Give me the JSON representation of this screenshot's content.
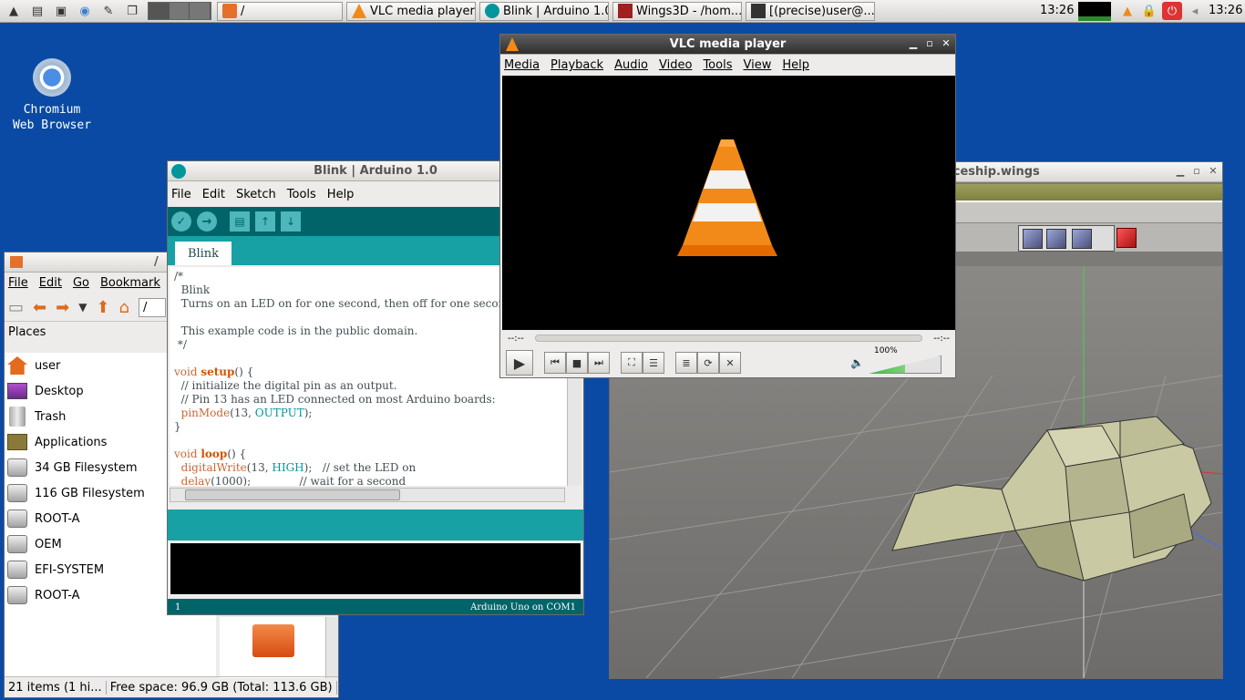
{
  "taskbar": {
    "tasks": {
      "files": "/",
      "vlc": "VLC media player",
      "arduino": "Blink | Arduino 1.0",
      "wings": "Wings3D - /hom...",
      "term": "[(precise)user@..."
    },
    "clock1": "13:26",
    "clock2": "13:26"
  },
  "desktop": {
    "icon_line1": "Chromium",
    "icon_line2": "Web Browser"
  },
  "filemanager": {
    "title": "/",
    "menu": [
      "File",
      "Edit",
      "Go",
      "Bookmark"
    ],
    "path": "/",
    "places_header": "Places",
    "places": [
      "user",
      "Desktop",
      "Trash",
      "Applications",
      "34 GB Filesystem",
      "116 GB Filesystem",
      "ROOT-A",
      "OEM",
      "EFI-SYSTEM",
      "ROOT-A"
    ],
    "status_items": "21 items (1 hi...",
    "status_space": "Free space: 96.9 GB (Total: 113.6 GB)"
  },
  "arduino": {
    "title": "Blink | Arduino 1.0",
    "menu": [
      "File",
      "Edit",
      "Sketch",
      "Tools",
      "Help"
    ],
    "tab": "Blink",
    "footer_line": "1",
    "footer_board": "Arduino Uno on COM1"
  },
  "wings": {
    "title": "aceship.wings"
  },
  "vlc": {
    "title": "VLC media player",
    "menu": [
      "Media",
      "Playback",
      "Audio",
      "Video",
      "Tools",
      "View",
      "Help"
    ],
    "time_left": "--:--",
    "time_right": "--:--",
    "volume": "100%"
  }
}
